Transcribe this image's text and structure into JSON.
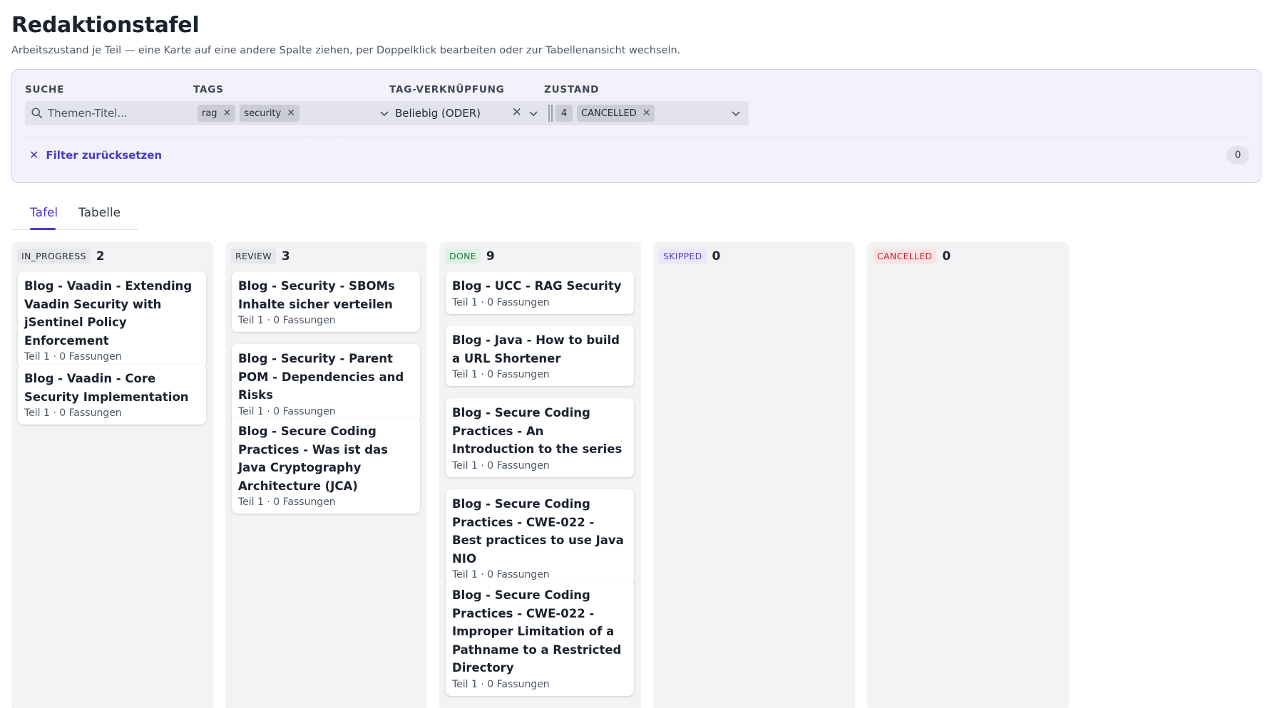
{
  "page": {
    "title": "Redaktionstafel",
    "subtitle": "Arbeitszustand je Teil — eine Karte auf eine andere Spalte ziehen, per Doppelklick bearbeiten oder zur Tabellenansicht wechseln."
  },
  "filters": {
    "search": {
      "label": "SUCHE",
      "placeholder": "Themen-Titel...",
      "icon": "search-icon"
    },
    "tags": {
      "label": "TAGS",
      "selected": [
        "rag",
        "security"
      ]
    },
    "tag_link": {
      "label": "TAG-VERKNÜPFUNG",
      "value": "Beliebig (ODER)"
    },
    "state": {
      "label": "ZUSTAND",
      "hidden_count": "4",
      "selected": [
        "CANCELLED"
      ]
    },
    "reset_label": "Filter zurücksetzen",
    "result_count": "0"
  },
  "tabs": [
    {
      "label": "Tafel",
      "active": true
    },
    {
      "label": "Tabelle",
      "active": false
    }
  ],
  "colors": {
    "accent": "#4a3cc4",
    "in_progress_bg": "#e6e7ec",
    "review_bg": "#e6e7ec",
    "done_bg": "#ddf1e3",
    "skipped_bg": "#ebe6fb",
    "cancelled_bg": "#fbe3e3"
  },
  "columns": [
    {
      "status": "IN_PROGRESS",
      "count": "2",
      "cards": [
        {
          "title": "Blog - Vaadin - Extending Vaadin Security with jSentinel Policy Enforcement",
          "meta": "Teil 1 · 0 Fassungen"
        },
        {
          "title": "Blog - Vaadin - Core Security Implementation",
          "meta": "Teil 1 · 0 Fassungen"
        }
      ]
    },
    {
      "status": "REVIEW",
      "count": "3",
      "cards": [
        {
          "title": "Blog - Security - SBOMs Inhalte sicher verteilen",
          "meta": "Teil 1 · 0 Fassungen"
        },
        {
          "title": "Blog - Security - Parent POM - Dependencies and Risks",
          "meta": "Teil 1 · 0 Fassungen"
        },
        {
          "title": "Blog - Secure Coding Practices - Was ist das Java Cryptography Architecture (JCA)",
          "meta": "Teil 1 · 0 Fassungen"
        }
      ]
    },
    {
      "status": "DONE",
      "count": "9",
      "cards": [
        {
          "title": "Blog - UCC - RAG Security",
          "meta": "Teil 1 · 0 Fassungen"
        },
        {
          "title": "Blog - Java - How to build a URL Shortener",
          "meta": "Teil 1 · 0 Fassungen"
        },
        {
          "title": "Blog - Secure Coding Practices - An Introduction to the series",
          "meta": "Teil 1 · 0 Fassungen"
        },
        {
          "title": "Blog - Secure Coding Practices - CWE-022 - Best practices to use Java NIO",
          "meta": "Teil 1 · 0 Fassungen"
        },
        {
          "title": "Blog - Secure Coding Practices - CWE-022 - Improper Limitation of a Pathname to a Restricted Directory",
          "meta": "Teil 1 · 0 Fassungen"
        }
      ]
    },
    {
      "status": "SKIPPED",
      "count": "0",
      "cards": []
    },
    {
      "status": "CANCELLED",
      "count": "0",
      "cards": []
    }
  ]
}
